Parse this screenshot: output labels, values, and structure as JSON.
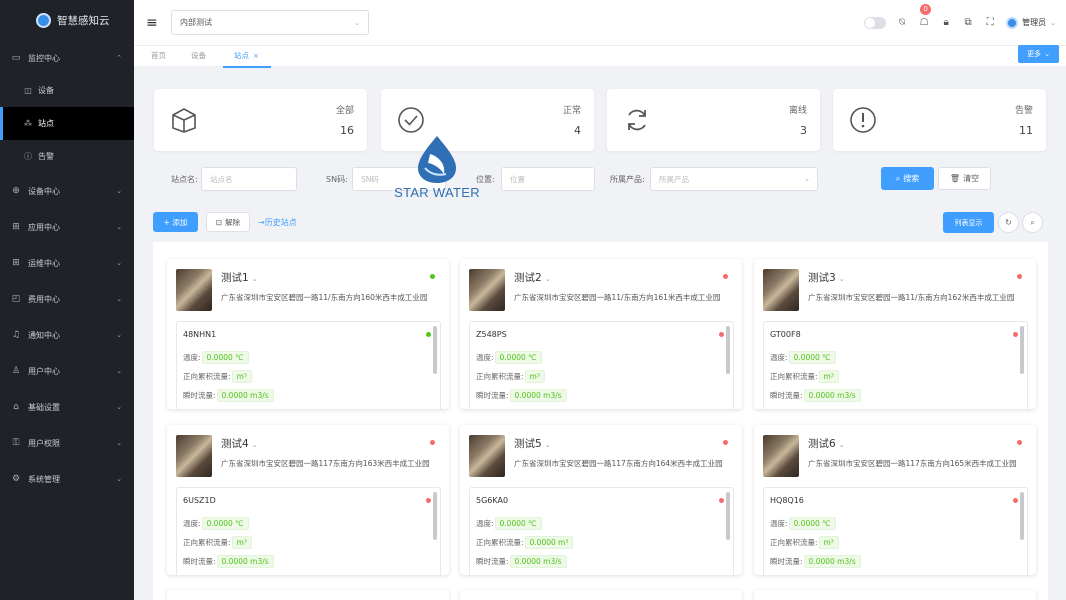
{
  "app": {
    "name": "智慧感知云"
  },
  "sidebar": {
    "items": [
      {
        "label": "监控中心",
        "icon": "monitor-icon",
        "expanded": true
      },
      {
        "label": "设备中心",
        "icon": "device-icon"
      },
      {
        "label": "应用中心",
        "icon": "app-grid-icon"
      },
      {
        "label": "运维中心",
        "icon": "ops-icon"
      },
      {
        "label": "费用中心",
        "icon": "wallet-icon"
      },
      {
        "label": "通知中心",
        "icon": "bell-icon"
      },
      {
        "label": "用户中心",
        "icon": "user-icon"
      },
      {
        "label": "基础设置",
        "icon": "settings-icon"
      },
      {
        "label": "用户权限",
        "icon": "key-icon"
      },
      {
        "label": "系统管理",
        "icon": "gear-icon"
      }
    ],
    "subitems": [
      {
        "label": "设备",
        "icon": "device-icon"
      },
      {
        "label": "站点",
        "icon": "site-icon",
        "active": true
      },
      {
        "label": "告警",
        "icon": "alert-icon"
      }
    ]
  },
  "topbar": {
    "project": "内部测试",
    "notify_count": "0",
    "user": "管理员"
  },
  "tabs": {
    "items": [
      "首页",
      "设备",
      "站点"
    ],
    "more": "更多"
  },
  "stats": [
    {
      "label": "全部",
      "value": "16",
      "icon": "box-icon"
    },
    {
      "label": "正常",
      "value": "4",
      "icon": "check-circle-icon"
    },
    {
      "label": "离线",
      "value": "3",
      "icon": "refresh-icon"
    },
    {
      "label": "告警",
      "value": "11",
      "icon": "exclamation-circle-icon"
    }
  ],
  "filters": {
    "site_name_label": "站点名:",
    "site_name_placeholder": "站点名",
    "sn_label": "SN码:",
    "sn_placeholder": "SN码",
    "location_label": "位置:",
    "location_placeholder": "位置",
    "product_label": "所属产品:",
    "product_placeholder": "所属产品",
    "search": "搜索",
    "clear": "清空"
  },
  "actions": {
    "add": "+ 添加",
    "unbind": "解除",
    "history": "历史站点",
    "list_view": "列表显示"
  },
  "watermark": {
    "text": "STAR WATER"
  },
  "cards": [
    {
      "name": "测试1",
      "address": "广东省深圳市宝安区碧园一路11/东南方向160米西丰成工业园",
      "status": "green",
      "sensor": {
        "sn": "48NHN1",
        "status": "green"
      }
    },
    {
      "name": "测试2",
      "address": "广东省深圳市宝安区碧园一路11/东南方向161米西丰成工业园",
      "status": "red",
      "sensor": {
        "sn": "Z548PS",
        "status": "red"
      }
    },
    {
      "name": "测试3",
      "address": "广东省深圳市宝安区碧园一路11/东南方向162米西丰成工业园",
      "status": "red",
      "sensor": {
        "sn": "GT00F8",
        "status": "red"
      }
    },
    {
      "name": "测试4",
      "address": "广东省深圳市宝安区碧园一路117东南方向163米西丰成工业园",
      "status": "red",
      "sensor": {
        "sn": "6USZ1D",
        "status": "red"
      }
    },
    {
      "name": "测试5",
      "address": "广东省深圳市宝安区碧园一路117东南方向164米西丰成工业园",
      "status": "red",
      "sensor": {
        "sn": "5G6KA0",
        "status": "red"
      }
    },
    {
      "name": "测试6",
      "address": "广东省深圳市宝安区碧园一路117东南方向165米西丰成工业园",
      "status": "red",
      "sensor": {
        "sn": "HQ8Q16",
        "status": "red"
      }
    }
  ],
  "metrics": {
    "temp_label": "温度:",
    "temp_value": "0.0000 ℃",
    "flow_label": "正向累积流量:",
    "flow_value": "m³",
    "flow_value_alt": "0.0000 m³",
    "inst_label": "瞬时流量:",
    "inst_value": "0.0000 m3/s"
  }
}
